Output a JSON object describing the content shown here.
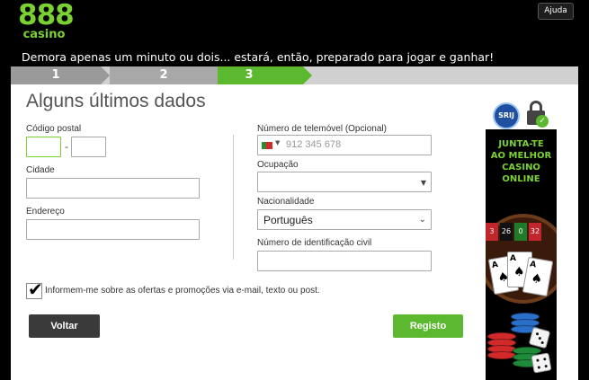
{
  "header": {
    "logo_digits": "888",
    "logo_word": "casino",
    "help_label": "Ajuda",
    "tagline": "Demora apenas um minuto ou dois... estará, então, preparado para jogar e ganhar!"
  },
  "steps": [
    {
      "label": "1",
      "state": "completed"
    },
    {
      "label": "2",
      "state": "completed"
    },
    {
      "label": "3",
      "state": "active"
    }
  ],
  "form": {
    "title": "Alguns últimos dados",
    "postal_label": "Código postal",
    "postal_part1": "",
    "postal_separator": "-",
    "postal_part2": "",
    "city_label": "Cidade",
    "city_value": "",
    "address_label": "Endereço",
    "address_value": "",
    "phone_label": "Número de telemóvel (Opcional)",
    "phone_placeholder": "912 345 678",
    "phone_country": "Portugal",
    "occupation_label": "Ocupação",
    "occupation_value": "",
    "nationality_label": "Nacionalidade",
    "nationality_value": "Português",
    "id_label": "Número de identificação civil",
    "id_value": "",
    "consent_checked": true,
    "consent_label": "Informem-me sobre as ofertas e promoções via e-mail, texto ou post.",
    "back_label": "Voltar",
    "submit_label": "Registo"
  },
  "ad": {
    "badge": "SRIJ",
    "line1": "JUNTA-TE",
    "line2": "AO MELHOR",
    "line3": "CASINO",
    "line4": "ONLINE",
    "wheel_numbers": [
      "3",
      "26",
      "0",
      "32"
    ],
    "cards": [
      "A",
      "A",
      "A"
    ]
  },
  "colors": {
    "brand_green": "#7ad131",
    "button_green": "#5cb82e",
    "button_dark": "#3a3a3a"
  }
}
